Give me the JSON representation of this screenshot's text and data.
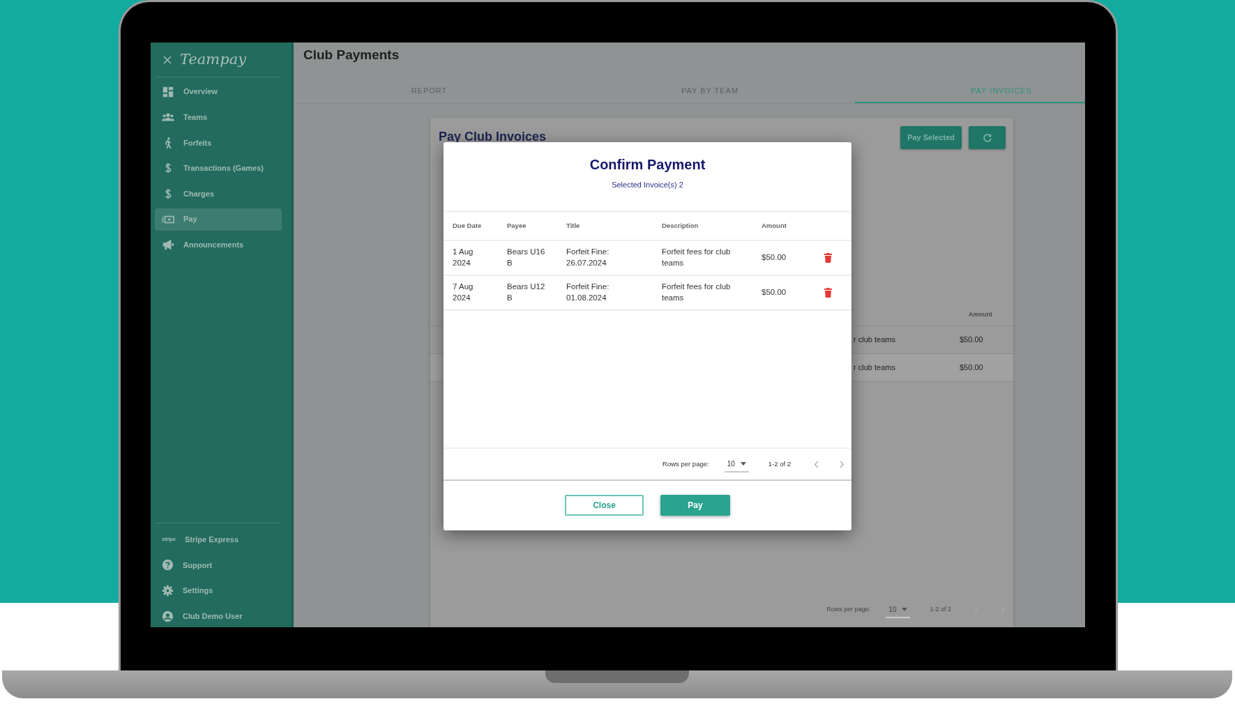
{
  "sidebar": {
    "brand": "Teampay",
    "items": [
      {
        "label": "Overview",
        "selected": false
      },
      {
        "label": "Teams",
        "selected": false
      },
      {
        "label": "Forfeits",
        "selected": false
      },
      {
        "label": "Transactions (Games)",
        "selected": false
      },
      {
        "label": "Charges",
        "selected": false
      },
      {
        "label": "Pay",
        "selected": true
      },
      {
        "label": "Announcements",
        "selected": false
      }
    ],
    "footer_items": [
      {
        "label": "Stripe Express",
        "logo": "stripe"
      },
      {
        "label": "Support"
      },
      {
        "label": "Settings"
      },
      {
        "label": "Club Demo User"
      }
    ]
  },
  "page": {
    "title": "Club Payments"
  },
  "tabs": [
    {
      "label": "REPORT",
      "selected": false
    },
    {
      "label": "PAY BY TEAM",
      "selected": false
    },
    {
      "label": "PAY INVOICES",
      "selected": true
    }
  ],
  "card": {
    "title": "Pay Club Invoices",
    "pay_selected_button": "Pay Selected",
    "table": {
      "columns": [
        "Amount"
      ],
      "rows": [
        {
          "column_1": "r club teams",
          "amount": "$50.00"
        },
        {
          "column_1": "r club teams",
          "amount": "$50.00"
        }
      ]
    },
    "pagination": {
      "rows_per_page_label": "Rows per page:",
      "rows_per_page": "10",
      "range": "1-2 of 2"
    }
  },
  "dialog": {
    "title": "Confirm Payment",
    "subtitle": "Selected Invoice(s) 2",
    "columns": [
      "Due Date",
      "Payee",
      "Title",
      "Description",
      "Amount"
    ],
    "rows": [
      {
        "due_date": "1 Aug 2024",
        "payee": "Bears U16 B",
        "title": "Forfeit Fine: 26.07.2024",
        "description": "Forfeit fees for club teams",
        "amount": "$50.00"
      },
      {
        "due_date": "7 Aug 2024",
        "payee": "Bears U12 B",
        "title": "Forfeit Fine: 01.08.2024",
        "description": "Forfeit fees for club teams",
        "amount": "$50.00"
      }
    ],
    "pagination": {
      "rows_per_page_label": "Rows per page:",
      "rows_per_page": "10",
      "range": "1-2 of 2"
    },
    "buttons": [
      {
        "label": "Close",
        "kind": "outline"
      },
      {
        "label": "Pay",
        "kind": "primary"
      }
    ]
  }
}
